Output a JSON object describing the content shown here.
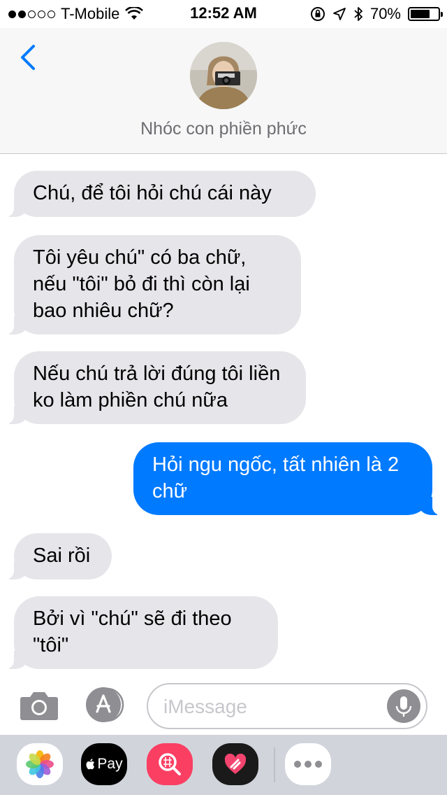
{
  "status_bar": {
    "carrier": "T-Mobile",
    "signal_bars_filled": 2,
    "signal_bars_total": 5,
    "time": "12:52 AM",
    "battery_percent": "70%",
    "battery_level": 0.7
  },
  "header": {
    "back_icon": "chevron-left-icon",
    "contact_name": "Nhóc con phiền phức"
  },
  "messages": [
    {
      "direction": "incoming",
      "text": "Chú, để tôi hỏi chú cái này"
    },
    {
      "direction": "incoming",
      "text": "Tôi yêu chú\" có ba chữ, nếu \"tôi\" bỏ đi thì còn lại bao nhiêu chữ?"
    },
    {
      "direction": "incoming",
      "text": "Nếu chú trả lời đúng tôi liền ko làm phiền chú nữa"
    },
    {
      "direction": "outgoing",
      "text": "Hỏi ngu ngốc, tất nhiên là 2 chữ"
    },
    {
      "direction": "incoming",
      "text": "Sai rồi"
    },
    {
      "direction": "incoming",
      "text": "Bởi vì \"chú\" sẽ đi theo \"tôi\""
    }
  ],
  "composer": {
    "placeholder": "iMessage",
    "camera_icon": "camera-icon",
    "appstore_icon": "app-store-icon",
    "mic_icon": "microphone-icon"
  },
  "app_drawer": {
    "apps": [
      {
        "name": "photos-app-icon"
      },
      {
        "name": "apple-pay-app-icon",
        "label": "Pay"
      },
      {
        "name": "search-images-app-icon"
      },
      {
        "name": "digital-touch-app-icon"
      },
      {
        "name": "more-apps-icon"
      }
    ]
  },
  "colors": {
    "incoming_bubble": "#e5e5ea",
    "outgoing_bubble": "#007aff",
    "accent": "#007aff",
    "header_bg": "#f7f7f7",
    "drawer_bg": "#d1d5db"
  }
}
